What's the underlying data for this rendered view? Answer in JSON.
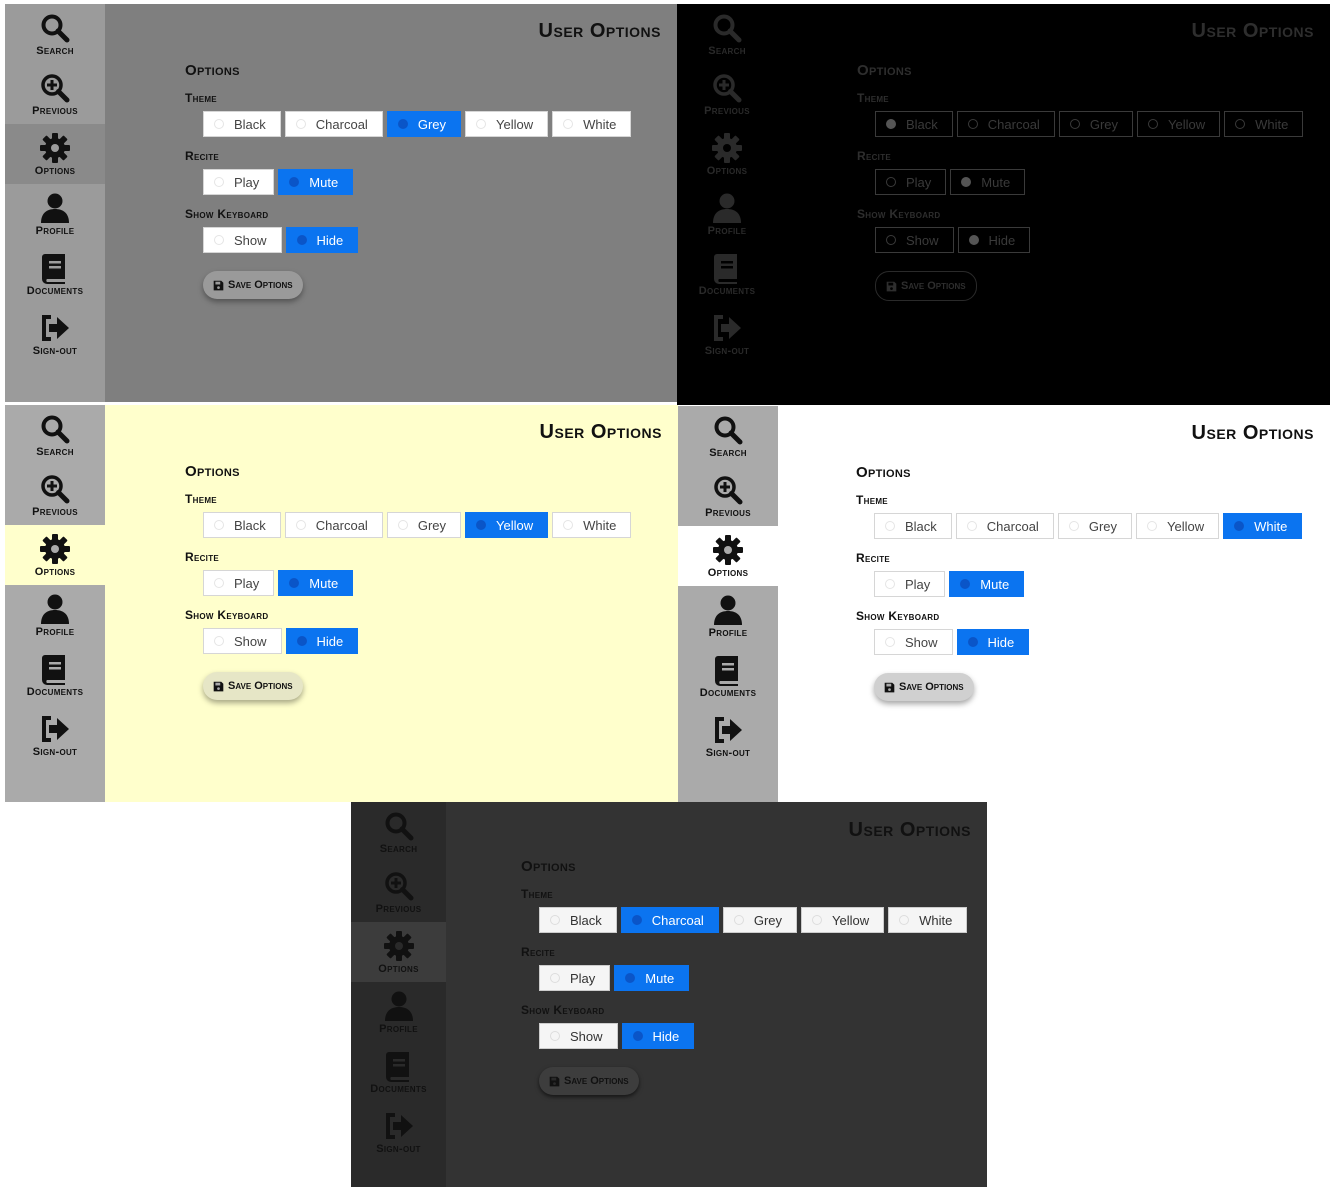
{
  "app": {
    "page_title": "User Options",
    "nav": [
      "Search",
      "Previous",
      "Options",
      "Profile",
      "Documents",
      "Sign-out"
    ],
    "nav_icons": [
      "search-icon",
      "zoom-in-icon",
      "gear-icon",
      "user-icon",
      "book-icon",
      "sign-out-icon"
    ],
    "options_heading": "Options",
    "theme_label": "Theme",
    "theme_options": [
      "Black",
      "Charcoal",
      "Grey",
      "Yellow",
      "White"
    ],
    "recite_label": "Recite",
    "recite_options": [
      "Play",
      "Mute"
    ],
    "keyboard_label": "Show Keyboard",
    "keyboard_options": [
      "Show",
      "Hide"
    ],
    "save_label": "Save Options",
    "save_icon": "floppy-disk-icon"
  },
  "variants": [
    {
      "name": "grey",
      "theme_selected": "Grey",
      "recite_selected": "Mute",
      "keyboard_selected": "Hide",
      "colors": {
        "bg": "#7f7f7f",
        "sidebar": "#9b9b9b",
        "active_nav": "#8a8a8a",
        "text": "#111111",
        "accent": "#0b74f0"
      }
    },
    {
      "name": "black",
      "theme_selected": "Black",
      "recite_selected": "Mute",
      "keyboard_selected": "Hide",
      "colors": {
        "bg": "#000000",
        "sidebar": "#000000",
        "active_nav": "#000000",
        "text": "#3a3a3a",
        "accent": "#000000"
      }
    },
    {
      "name": "yellow",
      "theme_selected": "Yellow",
      "recite_selected": "Mute",
      "keyboard_selected": "Hide",
      "colors": {
        "bg": "#ffffcc",
        "sidebar": "#aaaaaa",
        "active_nav": "#ffffcc",
        "text": "#111111",
        "accent": "#0b74f0"
      }
    },
    {
      "name": "white",
      "theme_selected": "White",
      "recite_selected": "Mute",
      "keyboard_selected": "Hide",
      "colors": {
        "bg": "#ffffff",
        "sidebar": "#aaaaaa",
        "active_nav": "#ffffff",
        "text": "#111111",
        "accent": "#0b74f0"
      }
    },
    {
      "name": "charcoal",
      "theme_selected": "Charcoal",
      "recite_selected": "Mute",
      "keyboard_selected": "Hide",
      "colors": {
        "bg": "#333333",
        "sidebar": "#2a2a2a",
        "active_nav": "#3c3c3c",
        "text": "#111111",
        "accent": "#0b74f0"
      }
    }
  ]
}
